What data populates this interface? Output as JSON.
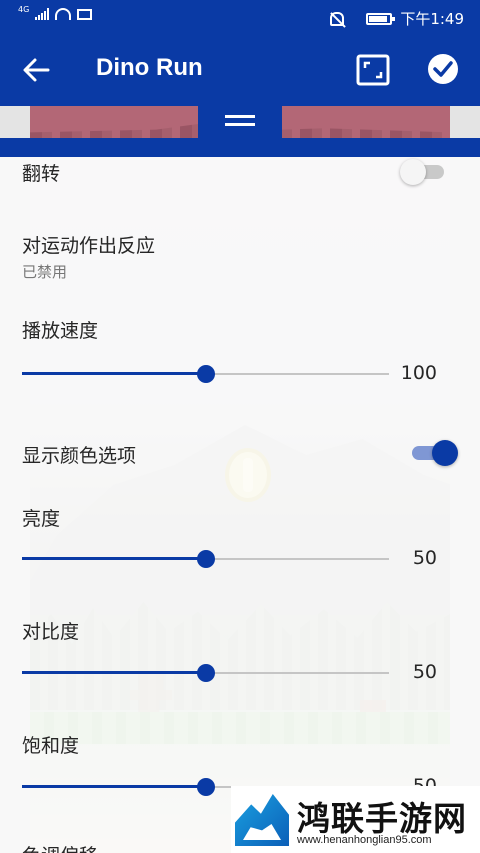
{
  "status_bar": {
    "network_label": "4G",
    "time": "下午1:49"
  },
  "app_bar": {
    "title": "Dino Run",
    "back_icon": "arrow-left-icon",
    "fullscreen_icon": "fullscreen-icon",
    "confirm_icon": "check-circle-icon"
  },
  "settings": {
    "flip": {
      "label": "翻转",
      "enabled": false
    },
    "motion": {
      "label": "对运动作出反应",
      "status": "已禁用"
    },
    "playback_speed": {
      "label": "播放速度",
      "value": "100",
      "level": 0.5
    },
    "color_options": {
      "label": "显示颜色选项",
      "enabled": true
    },
    "brightness": {
      "label": "亮度",
      "value": "50",
      "level": 0.5
    },
    "contrast": {
      "label": "对比度",
      "value": "50",
      "level": 0.5
    },
    "saturation": {
      "label": "饱和度",
      "value": "50",
      "level": 0.5
    },
    "hue_shift": {
      "label": "色调偏移"
    }
  },
  "watermark": {
    "title": "鸿联手游网",
    "url": "www.henanhonglian95.com"
  },
  "colors": {
    "primary": "#0a3aa5",
    "switch_on_track": "#7f97d4",
    "switch_off_track": "#c9c9c9"
  }
}
